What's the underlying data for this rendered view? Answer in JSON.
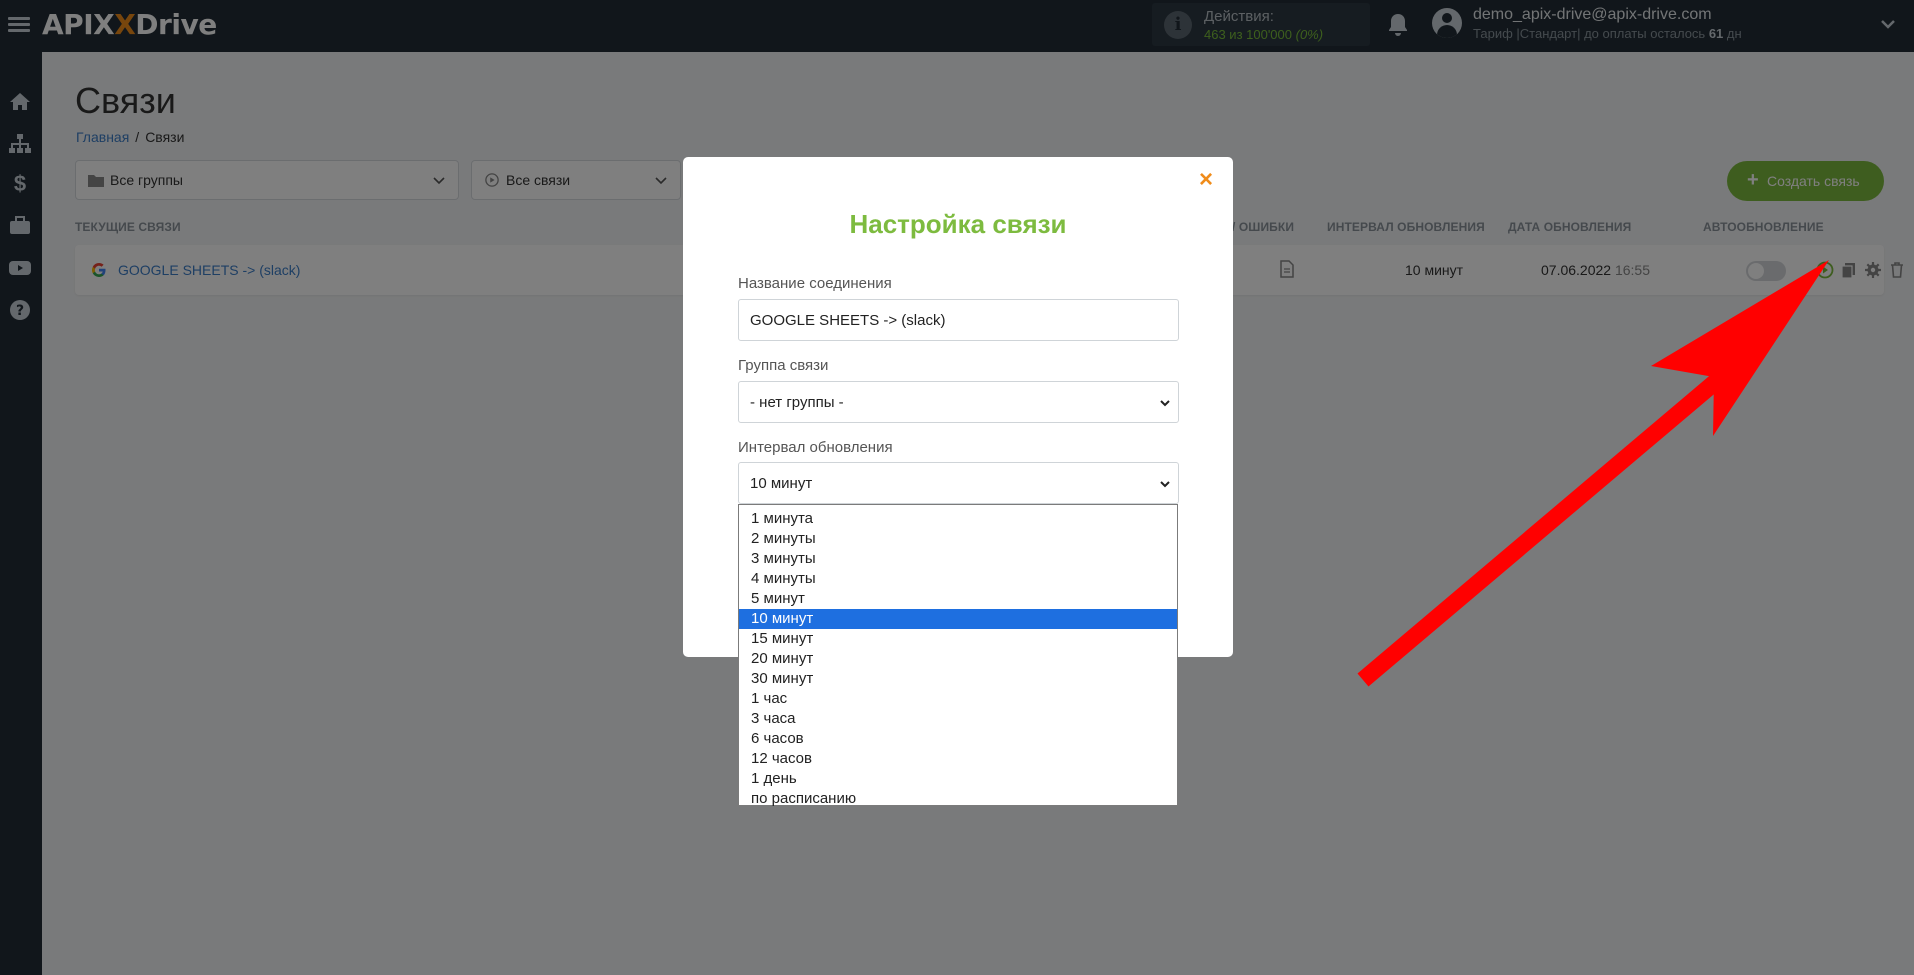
{
  "brand": {
    "logo_prefix": "APIX",
    "logo_suffix": "Drive"
  },
  "topbar": {
    "actions_title": "Действия:",
    "actions_value": "463 из 100'000",
    "actions_percent": "(0%)",
    "user_email": "demo_apix-drive@apix-drive.com",
    "user_plan_prefix": "Тариф |Стандарт| до оплаты осталось ",
    "user_plan_days": "61",
    "user_plan_suffix": " дн"
  },
  "sidebar": {
    "items": [
      "home-icon",
      "sitemap-icon",
      "dollar-icon",
      "briefcase-icon",
      "youtube-icon",
      "help-icon"
    ]
  },
  "page": {
    "title": "Связи",
    "breadcrumb": {
      "home": "Главная",
      "current": "Связи"
    }
  },
  "filters": {
    "groups": "Все группы",
    "connections": "Все связи"
  },
  "create_button": "Создать связь",
  "table": {
    "headers": {
      "current": "ТЕКУЩИЕ СВЯЗИ",
      "errors": "/ ОШИБКИ",
      "interval": "ИНТЕРВАЛ ОБНОВЛЕНИЯ",
      "date": "ДАТА ОБНОВЛЕНИЯ",
      "autoupdate": "АВТООБНОВЛЕНИЕ"
    },
    "row": {
      "name": "GOOGLE SHEETS -> (slack)",
      "interval": "10 минут",
      "date": "07.06.2022",
      "time": "16:55",
      "autoupdate_on": false
    }
  },
  "modal": {
    "title": "Настройка связи",
    "close_glyph": "×",
    "name_label": "Название соединения",
    "name_value": "GOOGLE SHEETS -> (slack)",
    "group_label": "Группа связи",
    "group_value": "- нет группы -",
    "interval_label": "Интервал обновления",
    "interval_value": "10 минут"
  },
  "interval_options": [
    "1 минута",
    "2 минуты",
    "3 минуты",
    "4 минуты",
    "5 минут",
    "10 минут",
    "15 минут",
    "20 минут",
    "30 минут",
    "1 час",
    "3 часа",
    "6 часов",
    "12 часов",
    "1 день",
    "по расписанию"
  ],
  "interval_selected_index": 5,
  "colors": {
    "accent_green": "#7dbb3f",
    "close_orange": "#f08c1a",
    "link_blue": "#3d7ec8",
    "selected_option": "#1e6fe0",
    "annotation_arrow": "#ff0000"
  }
}
